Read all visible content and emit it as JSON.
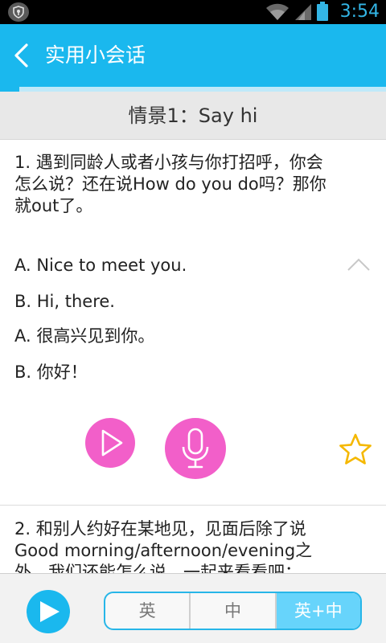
{
  "status_bar": {
    "time": "3:54"
  },
  "title_bar": {
    "title": "实用小会话"
  },
  "progress": {
    "fraction": 0.05
  },
  "scene": {
    "title": "情景1：Say hi"
  },
  "lesson_1": {
    "question_lines": [
      "1. 遇到同龄人或者小孩与你打招呼，你会",
      "怎么说？还在说How do you do吗？那你",
      "就out了。"
    ],
    "dialog": [
      "A. Nice to meet you.",
      "B. Hi, there.",
      "A. 很高兴见到你。",
      "B. 你好！"
    ]
  },
  "lesson_2": {
    "question_lines": [
      "2. 和别人约好在某地见，见面后除了说",
      "Good morning/afternoon/evening之",
      "外，我们还能怎么说，一起来看看吧："
    ]
  },
  "language_toggle": {
    "options": [
      "英",
      "中",
      "英+中"
    ],
    "selected": "英+中"
  },
  "colors": {
    "accent": "#1ab8ee",
    "audio_buttons": "#f25fc9",
    "star": "#f5b800"
  },
  "icons": {
    "back": "chevron-left-icon",
    "collapse": "chevron-up-icon",
    "favorite": "star-icon",
    "play": "play-icon",
    "record": "microphone-icon"
  }
}
